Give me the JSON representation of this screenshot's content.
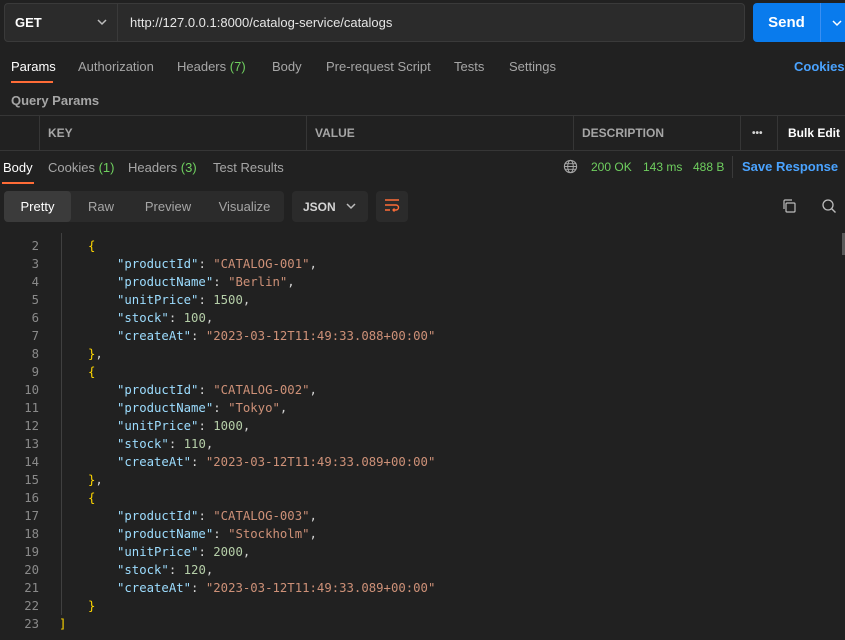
{
  "request": {
    "method": "GET",
    "url": "http://127.0.0.1:8000/catalog-service/catalogs",
    "send_label": "Send"
  },
  "request_tabs": {
    "params": "Params",
    "authorization": "Authorization",
    "headers_label": "Headers",
    "headers_count": "(7)",
    "body": "Body",
    "prerequest": "Pre-request Script",
    "tests": "Tests",
    "settings": "Settings",
    "cookies": "Cookies"
  },
  "query_params": {
    "title": "Query Params",
    "columns": {
      "key": "KEY",
      "value": "VALUE",
      "description": "DESCRIPTION"
    },
    "more": "•••",
    "bulk_edit": "Bulk Edit"
  },
  "response_tabs": {
    "body": "Body",
    "cookies_label": "Cookies",
    "cookies_count": "(1)",
    "headers_label": "Headers",
    "headers_count": "(3)",
    "test_results": "Test Results"
  },
  "response_status": {
    "status": "200 OK",
    "time": "143 ms",
    "size": "488 B",
    "save_label": "Save Response"
  },
  "format_toolbar": {
    "views": [
      "Pretty",
      "Raw",
      "Preview",
      "Visualize"
    ],
    "active_view": "Pretty",
    "language": "JSON"
  },
  "colors": {
    "accent": "#ff6c37",
    "send": "#097bed",
    "success": "#6fcf5f",
    "link": "#4aa3ff",
    "json_key": "#9cdcfe",
    "json_string": "#ce9178",
    "json_number": "#b5cea8"
  },
  "response_body": {
    "line_numbers": [
      "2",
      "3",
      "4",
      "5",
      "6",
      "7",
      "8",
      "9",
      "10",
      "11",
      "12",
      "13",
      "14",
      "15",
      "16",
      "17",
      "18",
      "19",
      "20",
      "21",
      "22",
      "23"
    ],
    "items": [
      {
        "productId": "CATALOG-001",
        "productName": "Berlin",
        "unitPrice": "1500",
        "stock": "100",
        "createAt": "2023-03-12T11:49:33.088+00:00"
      },
      {
        "productId": "CATALOG-002",
        "productName": "Tokyo",
        "unitPrice": "1000",
        "stock": "110",
        "createAt": "2023-03-12T11:49:33.089+00:00"
      },
      {
        "productId": "CATALOG-003",
        "productName": "Stockholm",
        "unitPrice": "2000",
        "stock": "120",
        "createAt": "2023-03-12T11:49:33.089+00:00"
      }
    ]
  }
}
